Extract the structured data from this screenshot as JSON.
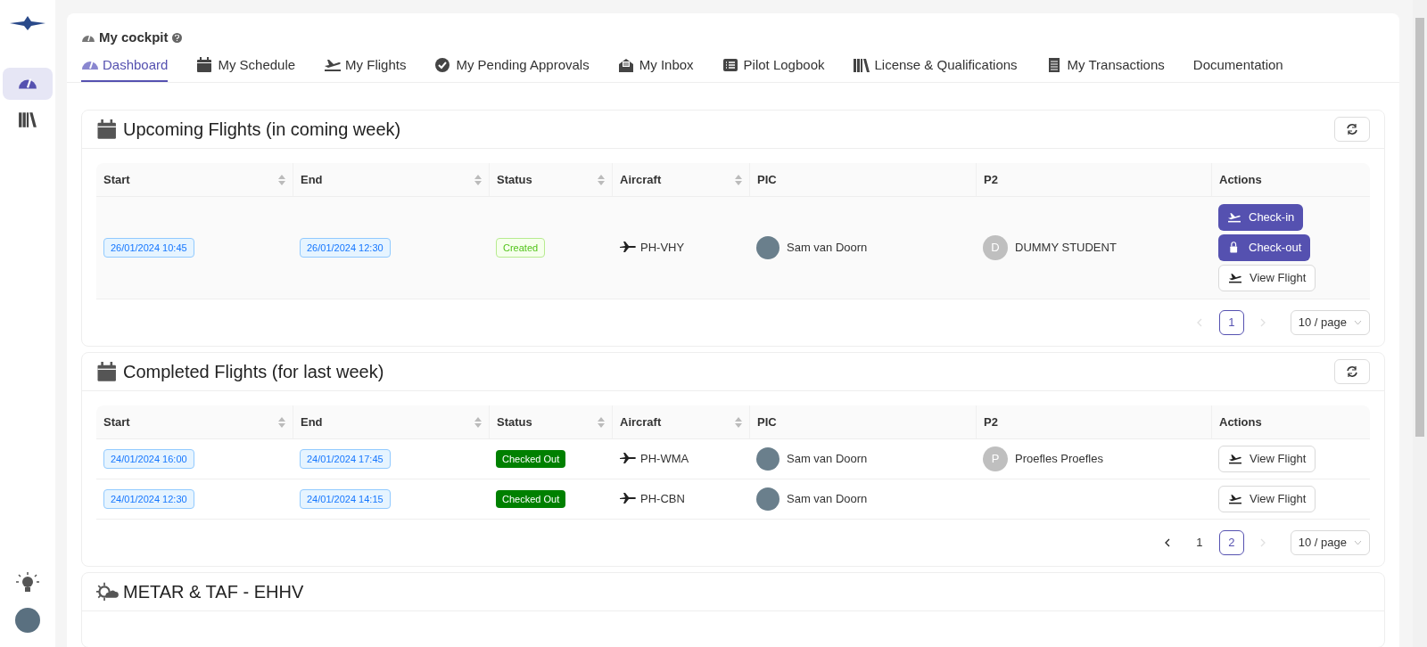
{
  "sidebar": {
    "items": [
      {
        "kind": "gauge",
        "selected": true
      },
      {
        "kind": "books",
        "selected": false
      }
    ]
  },
  "page": {
    "title": "My cockpit"
  },
  "tabs": [
    {
      "label": "Dashboard",
      "selected": true
    },
    {
      "label": "My Schedule",
      "selected": false
    },
    {
      "label": "My Flights",
      "selected": false
    },
    {
      "label": "My Pending Approvals",
      "selected": false
    },
    {
      "label": "My Inbox",
      "selected": false
    },
    {
      "label": "Pilot Logbook",
      "selected": false
    },
    {
      "label": "License & Qualifications",
      "selected": false
    },
    {
      "label": "My Transactions",
      "selected": false
    },
    {
      "label": "Documentation",
      "selected": false
    }
  ],
  "sections": [
    {
      "title": "Upcoming Flights (in coming week)",
      "columns": [
        {
          "label": "Start",
          "sortable": true
        },
        {
          "label": "End",
          "sortable": true
        },
        {
          "label": "Status",
          "sortable": true
        },
        {
          "label": "Aircraft",
          "sortable": true
        },
        {
          "label": "PIC",
          "sortable": false
        },
        {
          "label": "P2",
          "sortable": false
        },
        {
          "label": "Actions",
          "sortable": false
        }
      ],
      "rows": [
        {
          "start": "26/01/2024 10:45",
          "end": "26/01/2024 12:30",
          "status": {
            "label": "Created",
            "kind": "created"
          },
          "aircraft": "PH-VHY",
          "pic": "Sam van Doorn",
          "p2": {
            "initial": "D",
            "name": "DUMMY STUDENT"
          },
          "actions": [
            {
              "label": "Check-in",
              "kind": "checkin"
            },
            {
              "label": "Check-out",
              "kind": "checkout"
            },
            {
              "label": "View Flight",
              "kind": "view"
            }
          ]
        }
      ],
      "pagination": {
        "prev_disabled": true,
        "next_disabled": true,
        "pages": [
          {
            "label": "1",
            "selected": true
          }
        ],
        "page_size": "10 / page"
      }
    },
    {
      "title": "Completed Flights (for last week)",
      "columns": [
        {
          "label": "Start",
          "sortable": true
        },
        {
          "label": "End",
          "sortable": true
        },
        {
          "label": "Status",
          "sortable": true
        },
        {
          "label": "Aircraft",
          "sortable": true
        },
        {
          "label": "PIC",
          "sortable": false
        },
        {
          "label": "P2",
          "sortable": false
        },
        {
          "label": "Actions",
          "sortable": false
        }
      ],
      "rows": [
        {
          "start": "24/01/2024 16:00",
          "end": "24/01/2024 17:45",
          "status": {
            "label": "Checked Out",
            "kind": "checked_out"
          },
          "aircraft": "PH-WMA",
          "pic": "Sam van Doorn",
          "p2": {
            "initial": "P",
            "name": "Proefles Proefles"
          },
          "actions": [
            {
              "label": "View Flight",
              "kind": "view"
            }
          ]
        },
        {
          "start": "24/01/2024 12:30",
          "end": "24/01/2024 14:15",
          "status": {
            "label": "Checked Out",
            "kind": "checked_out"
          },
          "aircraft": "PH-CBN",
          "pic": "Sam van Doorn",
          "p2": null,
          "actions": [
            {
              "label": "View Flight",
              "kind": "view"
            }
          ]
        }
      ],
      "pagination": {
        "prev_disabled": false,
        "next_disabled": true,
        "pages": [
          {
            "label": "1",
            "selected": false
          },
          {
            "label": "2",
            "selected": true
          }
        ],
        "page_size": "10 / page"
      }
    },
    {
      "title": "METAR & TAF - EHHV"
    }
  ]
}
